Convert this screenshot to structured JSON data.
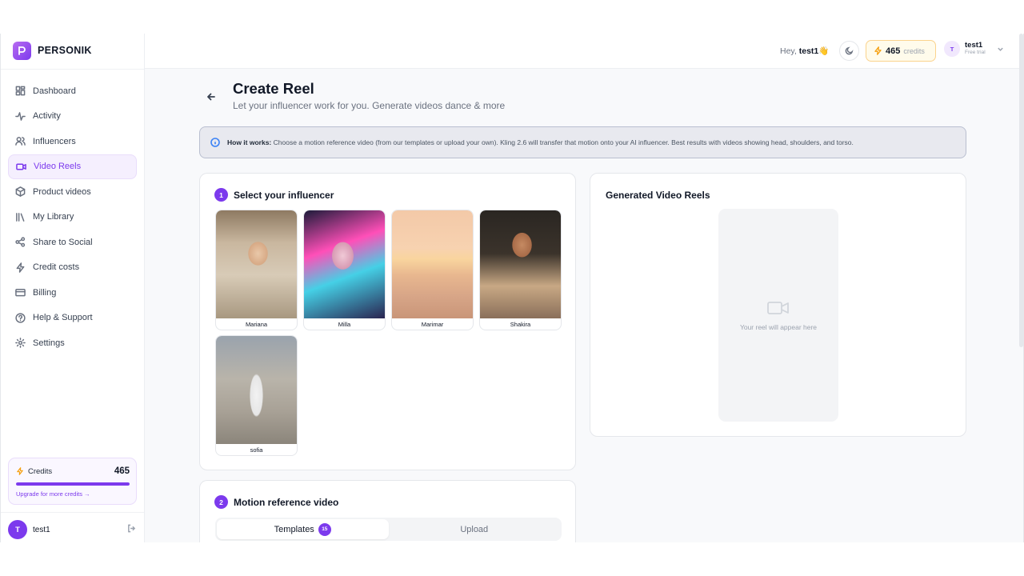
{
  "brand": {
    "name": "PERSONIK"
  },
  "sidebar": {
    "items": [
      {
        "label": "Dashboard",
        "icon": "dashboard-icon"
      },
      {
        "label": "Activity",
        "icon": "activity-icon"
      },
      {
        "label": "Influencers",
        "icon": "users-icon"
      },
      {
        "label": "Video Reels",
        "icon": "video-icon",
        "active": true
      },
      {
        "label": "Product videos",
        "icon": "box-icon"
      },
      {
        "label": "My Library",
        "icon": "library-icon"
      },
      {
        "label": "Share to Social",
        "icon": "share-icon"
      },
      {
        "label": "Credit costs",
        "icon": "bolt-icon"
      },
      {
        "label": "Billing",
        "icon": "card-icon"
      },
      {
        "label": "Help & Support",
        "icon": "help-icon"
      },
      {
        "label": "Settings",
        "icon": "gear-icon"
      }
    ],
    "credits": {
      "label": "Credits",
      "value": "465",
      "progress_fraction": 1.0,
      "upgrade": "Upgrade for more credits →"
    },
    "user": {
      "initial": "T",
      "name": "test1"
    }
  },
  "topbar": {
    "greeting": "Hey,",
    "username": "test1",
    "wave": "👋",
    "credits_value": "465",
    "credits_label": "credits",
    "user_initial": "T",
    "user_name": "test1",
    "user_plan": "Free trial"
  },
  "page": {
    "title": "Create Reel",
    "subtitle": "Let your influencer work for you. Generate videos dance & more"
  },
  "info": {
    "title": "How it works:",
    "text": "Choose a motion reference video (from our templates or upload your own). Kling 2.6 will transfer that motion onto your AI influencer. Best results with videos showing head, shoulders, and torso."
  },
  "step1": {
    "number": "1",
    "title": "Select your influencer",
    "influencers": [
      {
        "name": "Mariana"
      },
      {
        "name": "Milla"
      },
      {
        "name": "Marimar"
      },
      {
        "name": "Shakira"
      },
      {
        "name": "sofia"
      }
    ]
  },
  "reels": {
    "title": "Generated Video Reels",
    "placeholder": "Your reel will appear here"
  },
  "step2": {
    "number": "2",
    "title": "Motion reference video",
    "tabs": [
      {
        "label": "Templates",
        "badge": "15",
        "active": true
      },
      {
        "label": "Upload"
      }
    ]
  },
  "colors": {
    "accent": "#7c3aed",
    "accent_light": "#f5effe",
    "warning": "#f59e0b"
  }
}
